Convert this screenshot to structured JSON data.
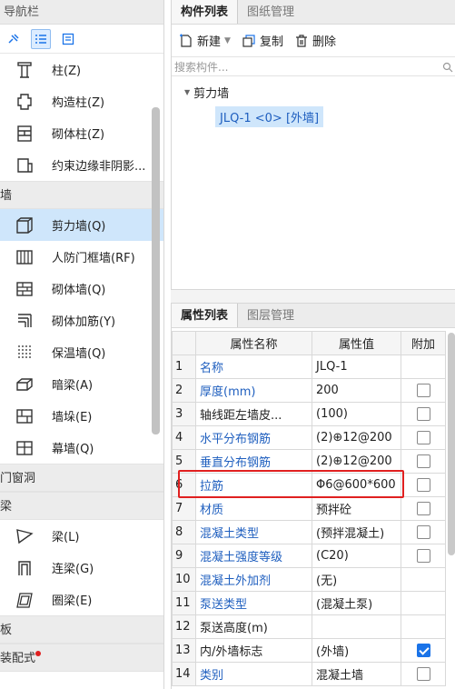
{
  "nav": {
    "title": "导航栏",
    "items_a": [
      {
        "label": "柱(Z)",
        "icon": "column-icon"
      },
      {
        "label": "构造柱(Z)",
        "icon": "constructional-column-icon"
      },
      {
        "label": "砌体柱(Z)",
        "icon": "masonry-column-icon"
      },
      {
        "label": "约束边缘非阴影...",
        "icon": "edge-constraint-icon"
      }
    ],
    "cat_wall": "墙",
    "items_wall": [
      {
        "label": "剪力墙(Q)",
        "icon": "shear-wall-icon",
        "selected": true
      },
      {
        "label": "人防门框墙(RF)",
        "icon": "civil-defense-door-wall-icon"
      },
      {
        "label": "砌体墙(Q)",
        "icon": "masonry-wall-icon"
      },
      {
        "label": "砌体加筋(Y)",
        "icon": "masonry-reinforcement-icon"
      },
      {
        "label": "保温墙(Q)",
        "icon": "insulation-wall-icon"
      },
      {
        "label": "暗梁(A)",
        "icon": "concealed-beam-icon"
      },
      {
        "label": "墙垛(E)",
        "icon": "wall-buttress-icon"
      },
      {
        "label": "幕墙(Q)",
        "icon": "curtain-wall-icon"
      }
    ],
    "cat_door": "门窗洞",
    "cat_beam": "梁",
    "items_beam": [
      {
        "label": "梁(L)",
        "icon": "beam-icon"
      },
      {
        "label": "连梁(G)",
        "icon": "coupling-beam-icon"
      },
      {
        "label": "圈梁(E)",
        "icon": "ring-beam-icon"
      }
    ],
    "cat_slab": "板",
    "cat_prefab": "装配式"
  },
  "components": {
    "tab_list": "构件列表",
    "tab_drawing": "图纸管理",
    "new_label": "新建",
    "copy_label": "复制",
    "delete_label": "删除",
    "search_placeholder": "搜索构件...",
    "tree_root": "剪力墙",
    "tree_child": "JLQ-1 <0> [外墙]"
  },
  "properties": {
    "tab_props": "属性列表",
    "tab_layers": "图层管理",
    "col_name": "属性名称",
    "col_value": "属性值",
    "col_extra": "附加",
    "rows": [
      {
        "n": "1",
        "name": "名称",
        "value": "JLQ-1",
        "blue": true,
        "checkbox": "none"
      },
      {
        "n": "2",
        "name": "厚度(mm)",
        "value": "200",
        "blue": true,
        "checkbox": "off"
      },
      {
        "n": "3",
        "name": "轴线距左墙皮...",
        "value": "(100)",
        "blue": false,
        "checkbox": "off"
      },
      {
        "n": "4",
        "name": "水平分布钢筋",
        "value": "(2)⊕12@200",
        "blue": true,
        "checkbox": "off"
      },
      {
        "n": "5",
        "name": "垂直分布钢筋",
        "value": "(2)⊕12@200",
        "blue": true,
        "checkbox": "off"
      },
      {
        "n": "6",
        "name": "拉筋",
        "value": "Φ6@600*600",
        "blue": true,
        "checkbox": "off"
      },
      {
        "n": "7",
        "name": "材质",
        "value": "预拌砼",
        "blue": true,
        "checkbox": "off"
      },
      {
        "n": "8",
        "name": "混凝土类型",
        "value": "(预拌混凝土)",
        "blue": true,
        "checkbox": "off"
      },
      {
        "n": "9",
        "name": "混凝土强度等级",
        "value": "(C20)",
        "blue": true,
        "checkbox": "off"
      },
      {
        "n": "10",
        "name": "混凝土外加剂",
        "value": "(无)",
        "blue": true,
        "checkbox": "none"
      },
      {
        "n": "11",
        "name": "泵送类型",
        "value": "(混凝土泵)",
        "blue": true,
        "checkbox": "none"
      },
      {
        "n": "12",
        "name": "泵送高度(m)",
        "value": "",
        "blue": false,
        "checkbox": "none"
      },
      {
        "n": "13",
        "name": "内/外墙标志",
        "value": "(外墙)",
        "blue": false,
        "checkbox": "on"
      },
      {
        "n": "14",
        "name": "类别",
        "value": "混凝土墙",
        "blue": true,
        "checkbox": "off"
      }
    ]
  },
  "colors": {
    "accent": "#1a73e8",
    "highlight": "#e02020",
    "selected_bg": "#cfe6fb",
    "label_blue": "#1f5fbf"
  }
}
